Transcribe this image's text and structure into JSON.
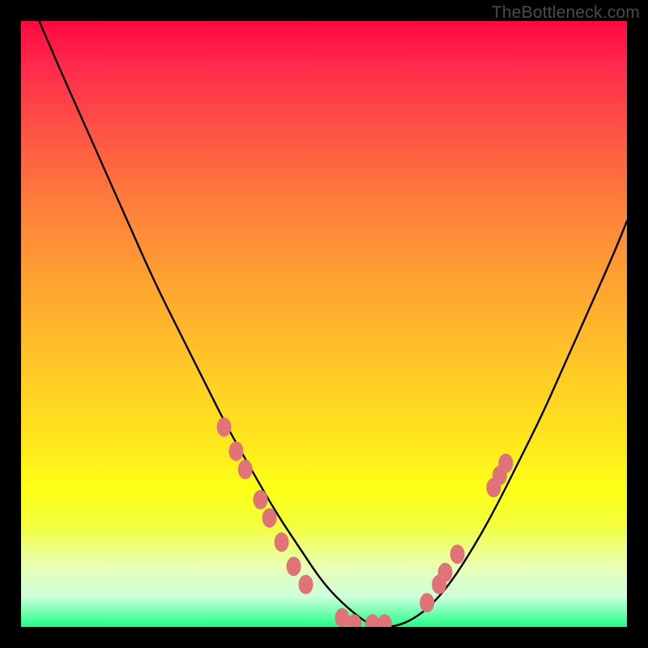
{
  "watermark": "TheBottleneck.com",
  "gradient_stops": [
    {
      "pct": 0,
      "color": "#ff0842"
    },
    {
      "pct": 8,
      "color": "#ff2d4b"
    },
    {
      "pct": 20,
      "color": "#ff5a43"
    },
    {
      "pct": 30,
      "color": "#ff7d3b"
    },
    {
      "pct": 40,
      "color": "#ff9a33"
    },
    {
      "pct": 50,
      "color": "#ffb52c"
    },
    {
      "pct": 60,
      "color": "#ffd024"
    },
    {
      "pct": 70,
      "color": "#ffe81d"
    },
    {
      "pct": 77,
      "color": "#fdff17"
    },
    {
      "pct": 83,
      "color": "#f3ff3a"
    },
    {
      "pct": 90,
      "color": "#e9ffb4"
    },
    {
      "pct": 95,
      "color": "#cdffdb"
    },
    {
      "pct": 100,
      "color": "#21ff88"
    }
  ],
  "chart_data": {
    "type": "line",
    "title": "",
    "xlabel": "",
    "ylabel": "",
    "xlim": [
      0,
      100
    ],
    "ylim": [
      0,
      100
    ],
    "series": [
      {
        "name": "bottleneck-curve",
        "x": [
          3,
          6,
          10,
          14,
          18,
          22,
          26,
          30,
          34,
          38,
          42,
          46,
          50,
          54,
          58,
          62,
          66,
          70,
          74,
          78,
          82,
          86,
          90,
          94,
          98,
          100
        ],
        "y": [
          100,
          93,
          84,
          75,
          66,
          57,
          49,
          41,
          33,
          26,
          19,
          13,
          7,
          3,
          0,
          0,
          2,
          6,
          12,
          19,
          27,
          35,
          44,
          53,
          62,
          67
        ]
      }
    ],
    "markers": {
      "name": "highlight-dots",
      "color": "#e07377",
      "points": [
        {
          "x": 33.5,
          "y": 33
        },
        {
          "x": 35.5,
          "y": 29
        },
        {
          "x": 37,
          "y": 26
        },
        {
          "x": 39.5,
          "y": 21
        },
        {
          "x": 41,
          "y": 18
        },
        {
          "x": 43,
          "y": 14
        },
        {
          "x": 45,
          "y": 10
        },
        {
          "x": 47,
          "y": 7
        },
        {
          "x": 53,
          "y": 1.5
        },
        {
          "x": 55,
          "y": 0.5
        },
        {
          "x": 58,
          "y": 0.5
        },
        {
          "x": 60,
          "y": 0.5
        },
        {
          "x": 67,
          "y": 4
        },
        {
          "x": 69,
          "y": 7
        },
        {
          "x": 70,
          "y": 9
        },
        {
          "x": 72,
          "y": 12
        },
        {
          "x": 78,
          "y": 23
        },
        {
          "x": 79,
          "y": 25
        },
        {
          "x": 80,
          "y": 27
        }
      ]
    }
  }
}
